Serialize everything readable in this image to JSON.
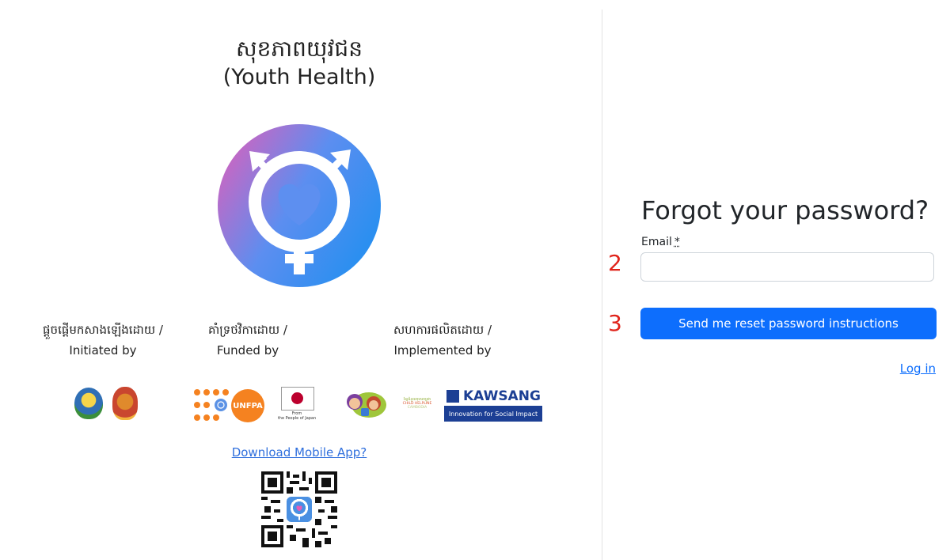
{
  "app": {
    "title_km": "សុខភាពយុវជន",
    "title_en": "(Youth Health)",
    "logo_icon": "gender-heart-logo-icon",
    "colors": {
      "logo_gradient_start": "#e85bb6",
      "logo_gradient_end": "#2b8ff0",
      "primary": "#0d6efd",
      "step_marker": "#e0231a"
    }
  },
  "credits": {
    "initiated": {
      "km": "ផ្តួចផ្តើមកសាងឡើងដោយ /",
      "en": "Initiated by"
    },
    "funded": {
      "km": "គាំទ្រថវិកាដោយ /",
      "en": "Funded by"
    },
    "implemented": {
      "km": "សហការផលិតដោយ /",
      "en": "Implemented by"
    }
  },
  "partners": {
    "unfpa": "UNFPA",
    "japan_caption": "From\nthe People of Japan",
    "child_helpline_km": "ខ្សែជំនួយកុមារកម្ពុជា",
    "child_helpline": "CHILD HELPLINE",
    "child_helpline_country": "CAMBODIA",
    "kawsang": "KAWSANG",
    "kawsang_tagline": "Innovation for Social Impact"
  },
  "download": {
    "link_text": "Download Mobile App?"
  },
  "form": {
    "heading": "Forgot your password?",
    "email_label": "Email",
    "required_marker": "*",
    "email_value": "",
    "email_placeholder": "",
    "submit_label": "Send me reset password instructions",
    "login_link": "Log in"
  },
  "annotations": {
    "step_2": "2",
    "step_3": "3"
  }
}
